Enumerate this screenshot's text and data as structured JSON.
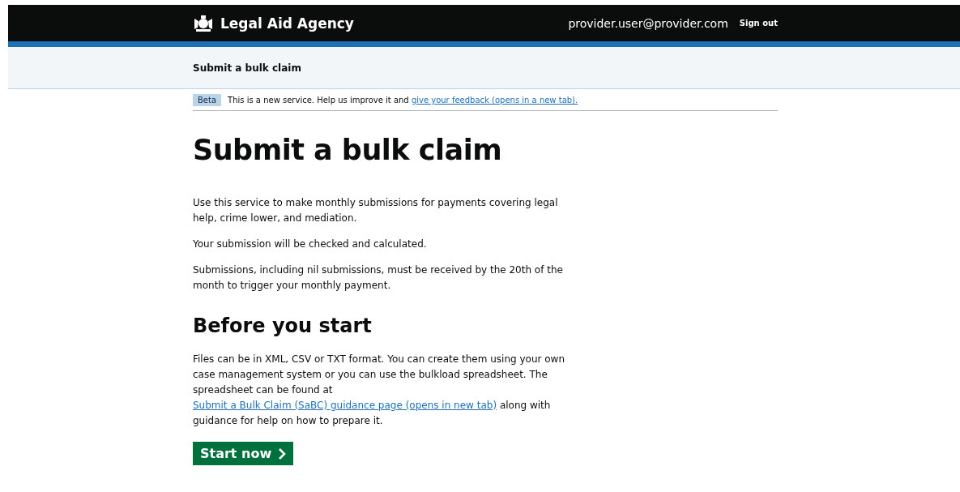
{
  "header": {
    "logo_text": "Legal Aid Agency",
    "user_email": "provider.user@provider.com",
    "sign_out": "Sign out"
  },
  "service_bar": {
    "title": "Submit a bulk claim"
  },
  "phase_banner": {
    "tag": "Beta",
    "text": "This is a new service. Help us improve it and ",
    "link": "give your feedback (opens in a new tab)."
  },
  "heading": "Submit a bulk claim",
  "intro": [
    "Use this service to make monthly submissions for payments covering legal help, crime lower, and mediation.",
    "Your submission will be checked and calculated.",
    "Submissions, including nil submissions, must be received by the 20th of the month to trigger your monthly payment."
  ],
  "before_you_start": {
    "heading": "Before you start",
    "text_before": "Files can be in XML, CSV or TXT format. You can create them using your own case management system or you can use the bulkload spreadsheet. The spreadsheet can be found at ",
    "link": "Submit a Bulk Claim (SaBC) guidance page (opens in new tab)",
    "text_after": " along with guidance for help on how to prepare it."
  },
  "start_button": {
    "label": "Start now"
  }
}
